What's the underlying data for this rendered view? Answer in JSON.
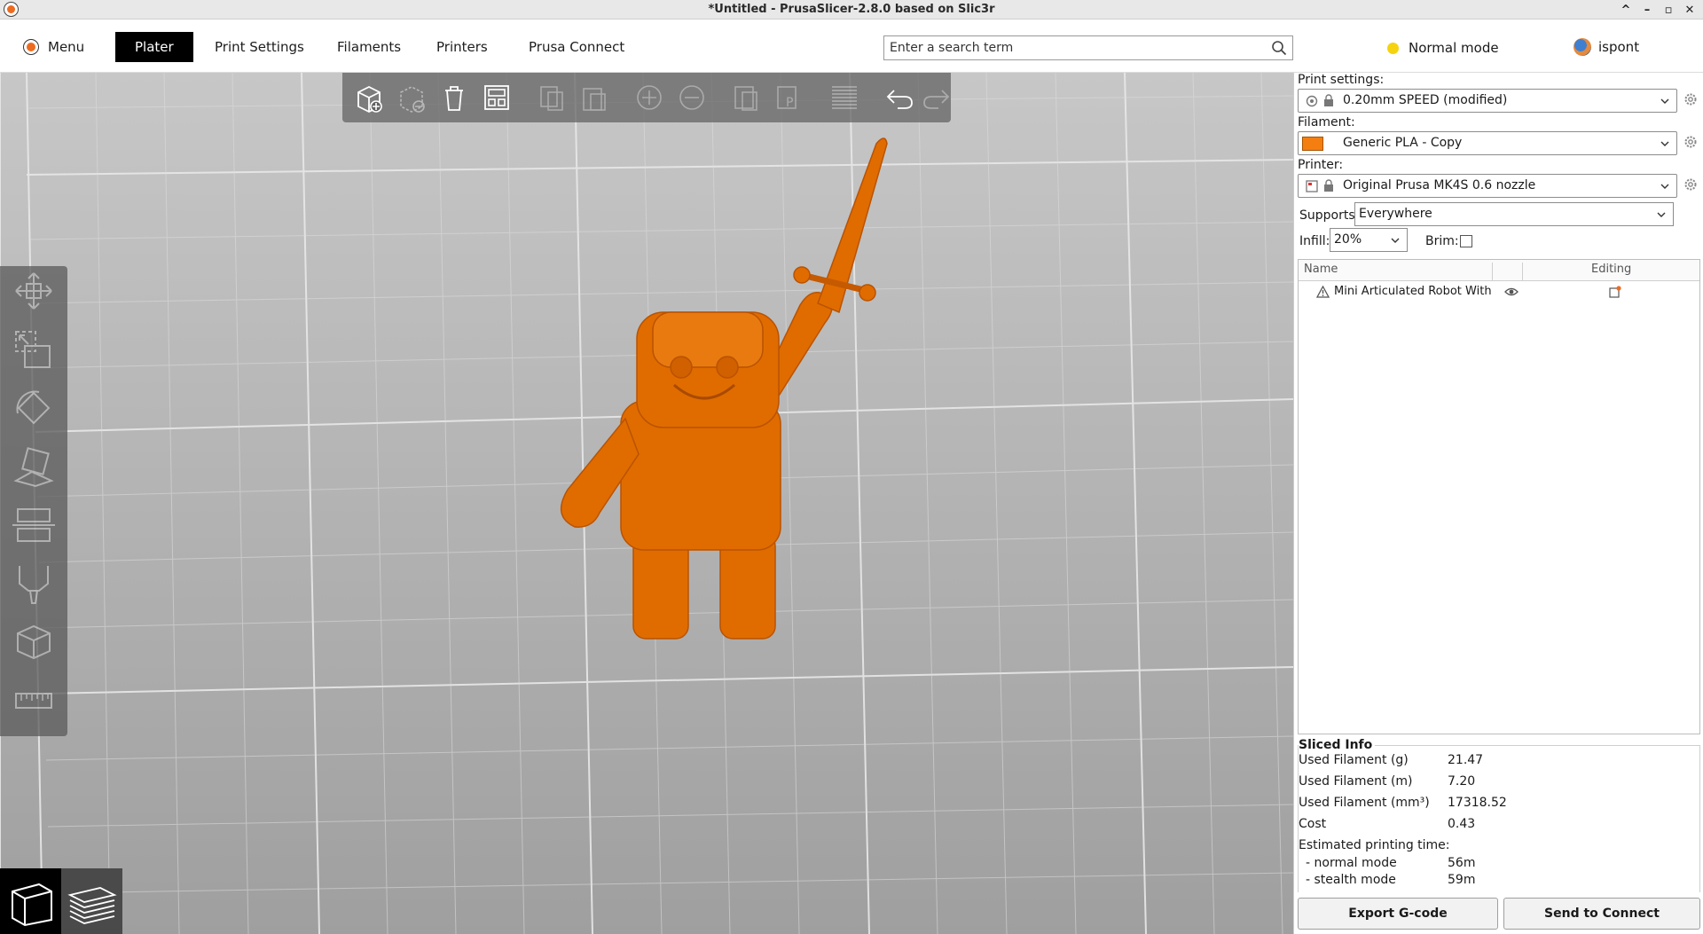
{
  "window": {
    "title": "*Untitled - PrusaSlicer-2.8.0 based on Slic3r",
    "controls": [
      "^",
      "–",
      "▫",
      "✕"
    ]
  },
  "tabs": {
    "menu": "Menu",
    "plater": "Plater",
    "print_settings": "Print Settings",
    "filaments": "Filaments",
    "printers": "Printers",
    "prusa_connect": "Prusa Connect"
  },
  "search": {
    "placeholder": "Enter a search term"
  },
  "mode": {
    "label": "Normal mode",
    "color": "#f5d311"
  },
  "user": {
    "name": "ispont"
  },
  "accent_color": "#ed6b21",
  "model_color": "#e06c00",
  "sidebar": {
    "print_settings_label": "Print settings:",
    "print_settings_value": "0.20mm SPEED (modified)",
    "filament_label": "Filament:",
    "filament_value": "Generic PLA - Copy",
    "filament_color": "#f57e10",
    "printer_label": "Printer:",
    "printer_value": "Original Prusa MK4S 0.6 nozzle",
    "supports_label": "Supports:",
    "supports_value": "Everywhere",
    "infill_label": "Infill:",
    "infill_value": "20%",
    "brim_label": "Brim:",
    "brim_checked": false
  },
  "object_list": {
    "col_name": "Name",
    "col_editing": "Editing",
    "objects": [
      {
        "name": "Mini Articulated Robot With S"
      }
    ]
  },
  "sliced_info": {
    "title": "Sliced Info",
    "rows": [
      {
        "label": "Used Filament (g)",
        "value": "21.47"
      },
      {
        "label": "Used Filament (m)",
        "value": "7.20"
      },
      {
        "label": "Used Filament (mm³)",
        "value": "17318.52"
      },
      {
        "label": "Cost",
        "value": "0.43"
      }
    ],
    "time_label": "Estimated printing time:",
    "normal_label": "- normal mode",
    "normal_value": "56m",
    "stealth_label": "- stealth mode",
    "stealth_value": "59m"
  },
  "buttons": {
    "export": "Export G-code",
    "send": "Send to Connect"
  }
}
